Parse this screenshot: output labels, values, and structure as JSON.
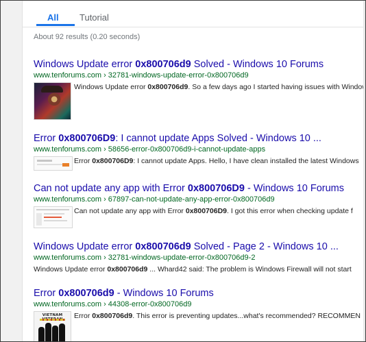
{
  "tabs": {
    "all": "All",
    "tutorial": "Tutorial"
  },
  "stats": "About 92 results (0.20 seconds)",
  "results": [
    {
      "title_pre": "Windows Update error ",
      "title_bold": "0x800706d9",
      "title_post": " Solved - Windows 10 Forums",
      "url": "www.tenforums.com › 32781-windows-update-error-0x800706d9",
      "snippet_pre": "Windows Update error ",
      "snippet_bold": "0x800706d9",
      "snippet_post": ". So a few days ago I started having issues with Windows",
      "thumb": "portrait-thumbnail"
    },
    {
      "title_pre": "Error ",
      "title_bold": "0x800706D9",
      "title_post": ": I cannot update Apps Solved - Windows 10 ...",
      "url": "www.tenforums.com › 58656-error-0x800706d9-i-cannot-update-apps",
      "snippet_pre": "Error ",
      "snippet_bold": "0x800706D9",
      "snippet_post": ": I cannot update Apps. Hello, I have clean installed the latest Windows",
      "thumb": "screenshot-thumbnail"
    },
    {
      "title_pre": "Can not update any app with Error ",
      "title_bold": "0x800706D9",
      "title_post": " - Windows 10 Forums",
      "url": "www.tenforums.com › 67897-can-not-update-any-app-error-0x800706d9",
      "snippet_pre": "Can not update any app with Error ",
      "snippet_bold": "0x800706D9",
      "snippet_post": ". I got this error when checking update f",
      "thumb": "store-screenshot-thumbnail"
    },
    {
      "title_pre": "Windows Update error ",
      "title_bold": "0x800706d9",
      "title_post": " Solved - Page 2 - Windows 10 ...",
      "url": "www.tenforums.com › 32781-windows-update-error-0x800706d9-2",
      "snippet_pre": "Windows Update error ",
      "snippet_bold": "0x800706d9",
      "snippet_post": " ... Whard42 said: The problem is Windows Firewall will not start",
      "thumb": ""
    },
    {
      "title_pre": "Error ",
      "title_bold": "0x800706d9",
      "title_post": " - Windows 10 Forums",
      "url": "www.tenforums.com › 44308-error-0x800706d9",
      "snippet_pre": "Error ",
      "snippet_bold": "0x800706d9",
      "snippet_post": ". This error is preventing updates...what's recommended? RECOMMEN",
      "thumb": "vietnam-veteran-thumbnail",
      "thumb_text": "VIETNAM VETERAN"
    }
  ],
  "colors": {
    "link": "#1a0dab",
    "url": "#006621",
    "tab_active": "#1a73e8",
    "meta": "#70757a"
  }
}
